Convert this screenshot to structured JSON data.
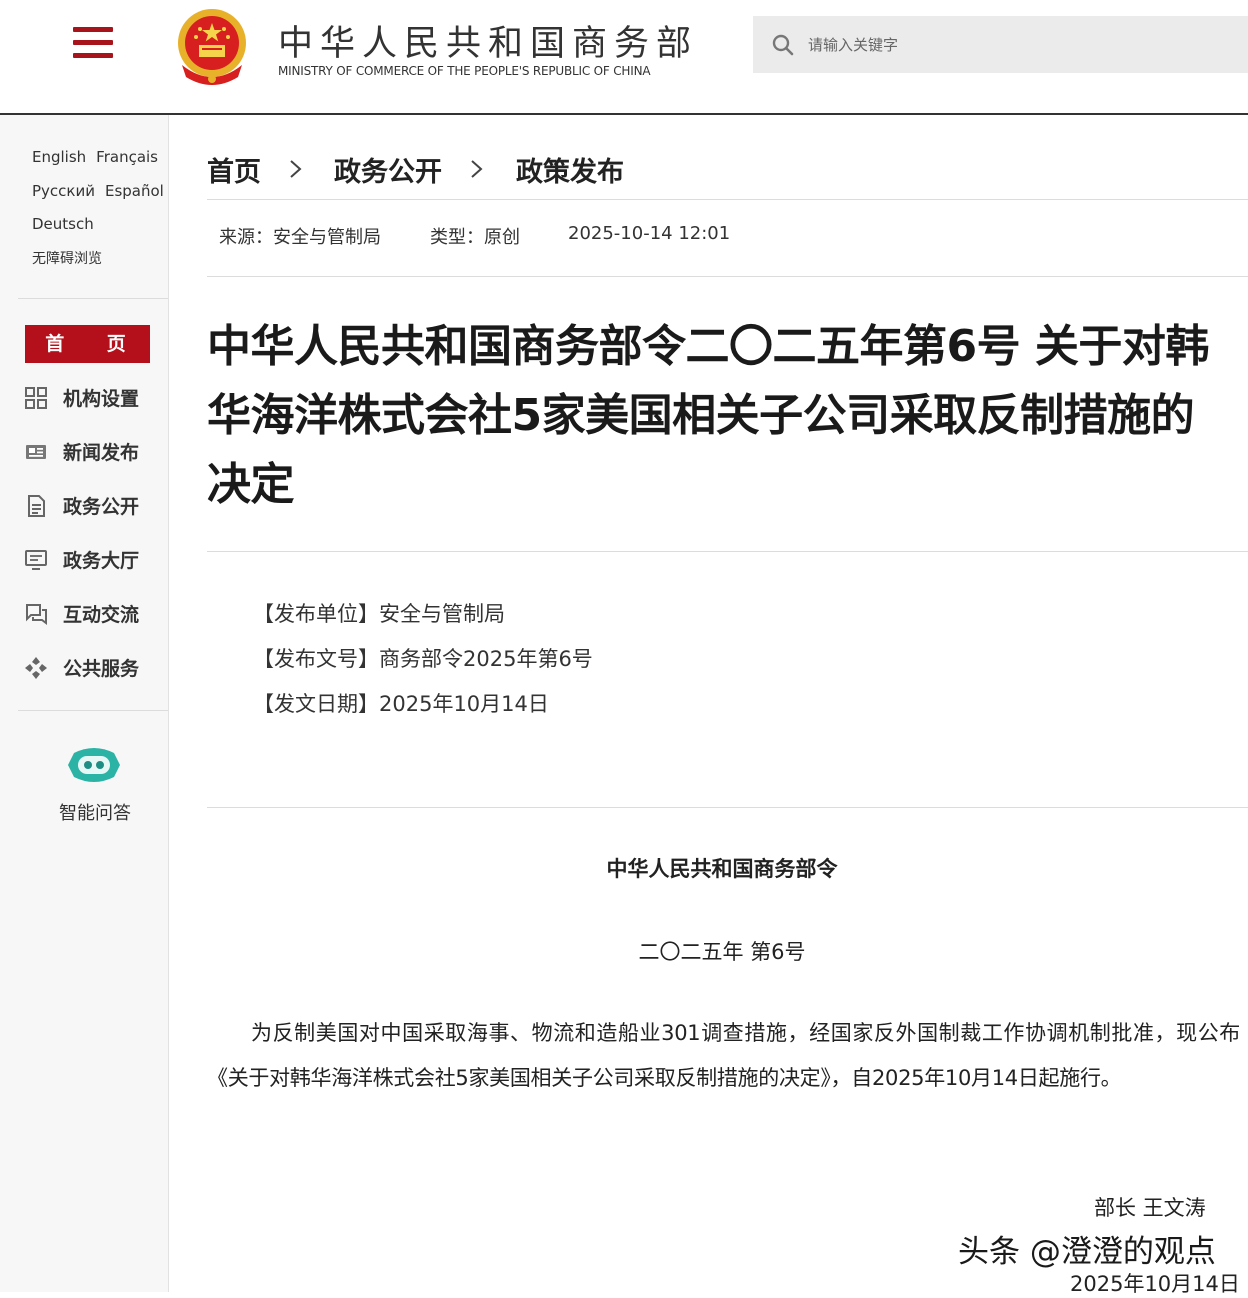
{
  "header": {
    "title": "中华人民共和国商务部",
    "subtitle": "MINISTRY OF COMMERCE OF THE PEOPLE'S REPUBLIC OF CHINA",
    "search_placeholder": "请输入关键字",
    "accent_color": "#b3101b"
  },
  "sidebar": {
    "languages": [
      [
        "English",
        "Français"
      ],
      [
        "Русский",
        "Español"
      ],
      [
        "Deutsch"
      ],
      [
        "无障碍浏览"
      ]
    ],
    "home_label": "首 页",
    "nav_items": [
      {
        "label": "机构设置",
        "icon": "grid-icon"
      },
      {
        "label": "新闻发布",
        "icon": "news-icon"
      },
      {
        "label": "政务公开",
        "icon": "document-icon"
      },
      {
        "label": "政务大厅",
        "icon": "monitor-icon"
      },
      {
        "label": "互动交流",
        "icon": "chat-icon"
      },
      {
        "label": "公共服务",
        "icon": "service-icon"
      }
    ],
    "assistant_label": "智能问答"
  },
  "breadcrumb": [
    "首页",
    "政务公开",
    "政策发布"
  ],
  "meta": {
    "source": "来源：安全与管制局",
    "type": "类型：原创",
    "datetime": "2025-10-14 12:01"
  },
  "article": {
    "title": "中华人民共和国商务部令二〇二五年第6号 关于对韩华海洋株式会社5家美国相关子公司采取反制措施的决定",
    "info": [
      "【发布单位】安全与管制局",
      "【发布文号】商务部令2025年第6号",
      "【发文日期】2025年10月14日"
    ],
    "heading": "中华人民共和国商务部令",
    "number": "二〇二五年 第6号",
    "body": "为反制美国对中国采取海事、物流和造船业301调查措施，经国家反外国制裁工作协调机制批准，现公布《关于对韩华海洋株式会社5家美国相关子公司采取反制措施的决定》，自2025年10月14日起施行。",
    "signature": "部长 王文涛",
    "sign_date": "2025年10月14日"
  },
  "watermark": "头条 @澄澄的观点"
}
